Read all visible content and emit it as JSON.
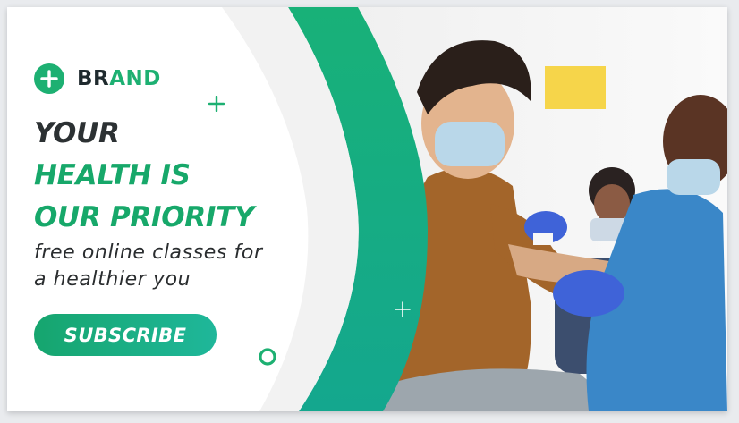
{
  "brand": {
    "name_part1": "BR",
    "name_part2": "AND",
    "icon": "plus-circle-icon"
  },
  "headline": {
    "line1": "YOUR",
    "line2": "HEALTH IS",
    "line3": "OUR PRIORITY"
  },
  "subtitle": {
    "line1": "free online classes for",
    "line2": "a healthier you"
  },
  "cta": {
    "label": "SUBSCRIBE"
  },
  "colors": {
    "brand_green": "#1db072",
    "gradient_start": "#16a56e",
    "gradient_end": "#1fb79a",
    "headline_dark": "#2c3133"
  },
  "decorations": [
    "plus-sparkle-icon",
    "plus-sparkle-icon",
    "ring-icon"
  ],
  "photo": {
    "description": "vaccination-photo"
  }
}
